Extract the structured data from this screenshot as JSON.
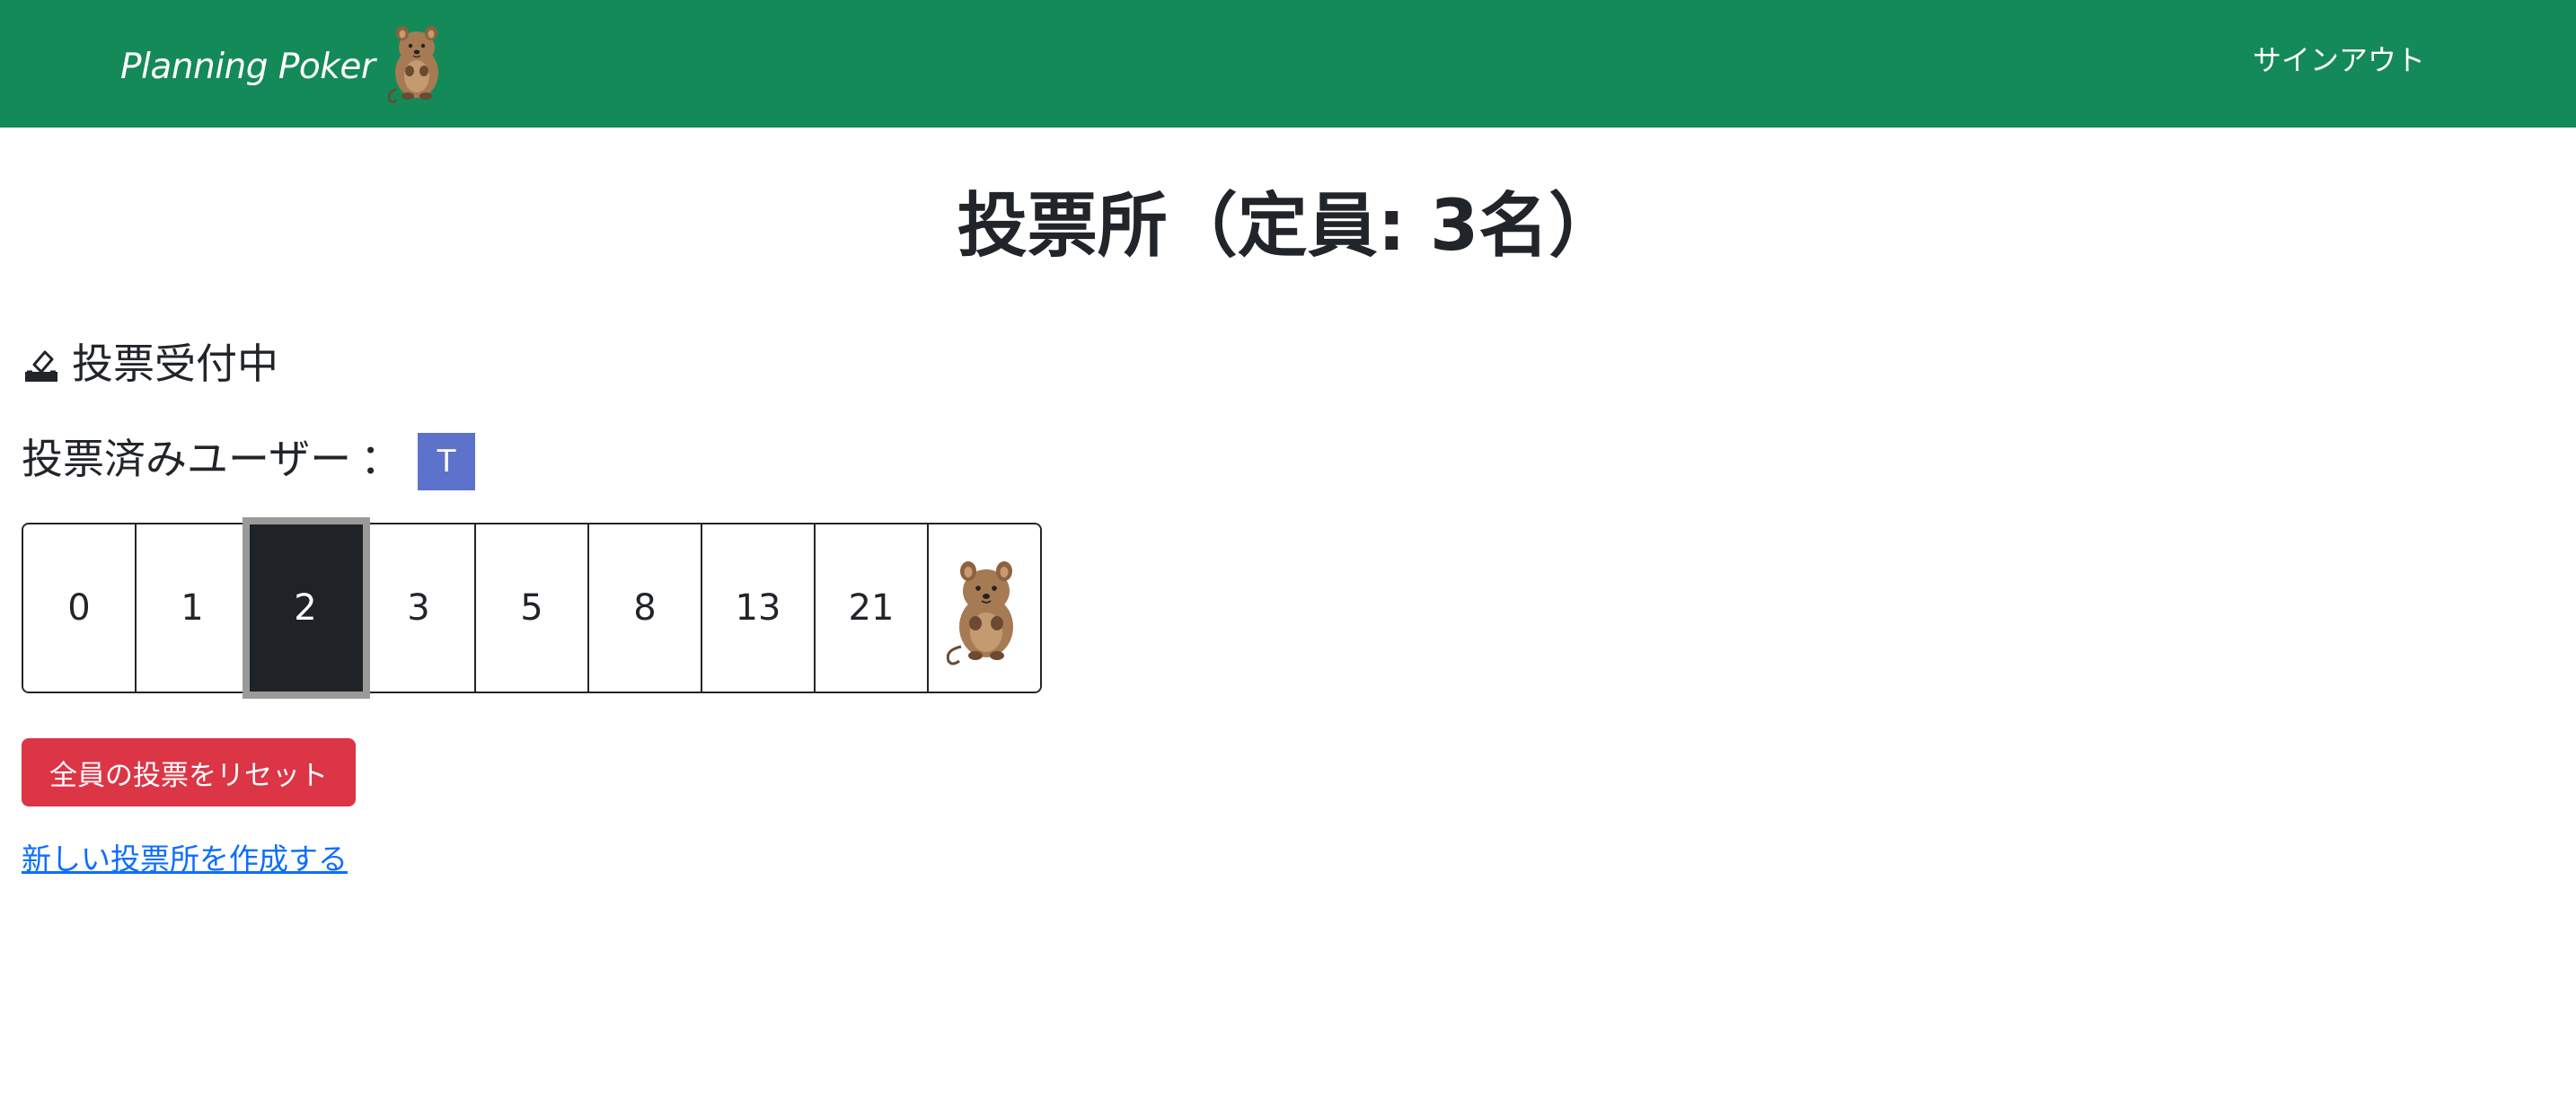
{
  "navbar": {
    "brand": "Planning Poker",
    "brand_logo_icon": "quokka-icon",
    "signout_label": "サインアウト",
    "background": "#138a57"
  },
  "main": {
    "title": "投票所（定員: 3名）",
    "status": {
      "icon": "ballot-box-icon",
      "text": "投票受付中"
    },
    "voted_users": {
      "label": "投票済みユーザー",
      "colon": "：",
      "users": [
        "T"
      ],
      "badge_color": "#5c72cb"
    },
    "cards": {
      "values": [
        "0",
        "1",
        "2",
        "3",
        "5",
        "8",
        "13",
        "21"
      ],
      "special_icon": "quokka-icon",
      "selected": "2"
    },
    "reset_button": {
      "label": "全員の投票をリセット",
      "color": "#dc3545"
    },
    "new_room_link": "新しい投票所を作成する"
  }
}
